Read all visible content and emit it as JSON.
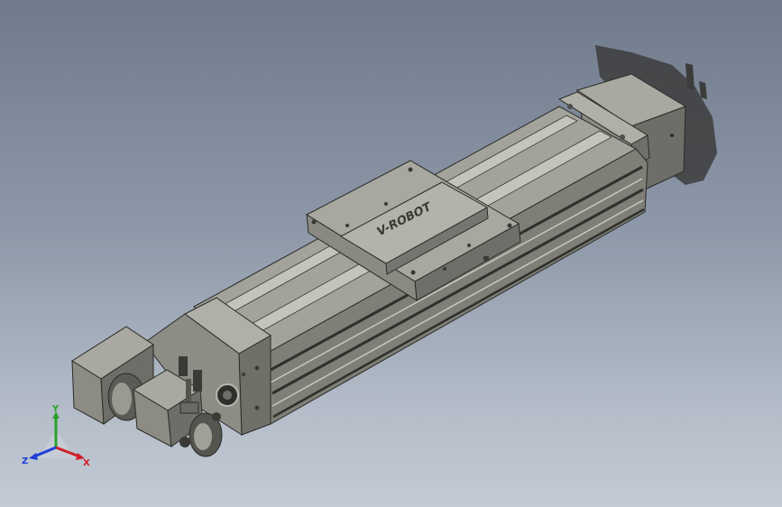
{
  "model": {
    "brand_text": "V-ROBOT"
  },
  "triad": {
    "x_label": "X",
    "y_label": "Y",
    "z_label": "Z",
    "x_color": "#d0202a",
    "y_color": "#2ca02c",
    "z_color": "#1f3fd6"
  },
  "colors": {
    "metal_top": "#a3a39b",
    "metal_side": "#7f7f78",
    "metal_dark": "#4e4e4a",
    "edge": "#2b2b28",
    "shadow": "#3a3a3a"
  }
}
